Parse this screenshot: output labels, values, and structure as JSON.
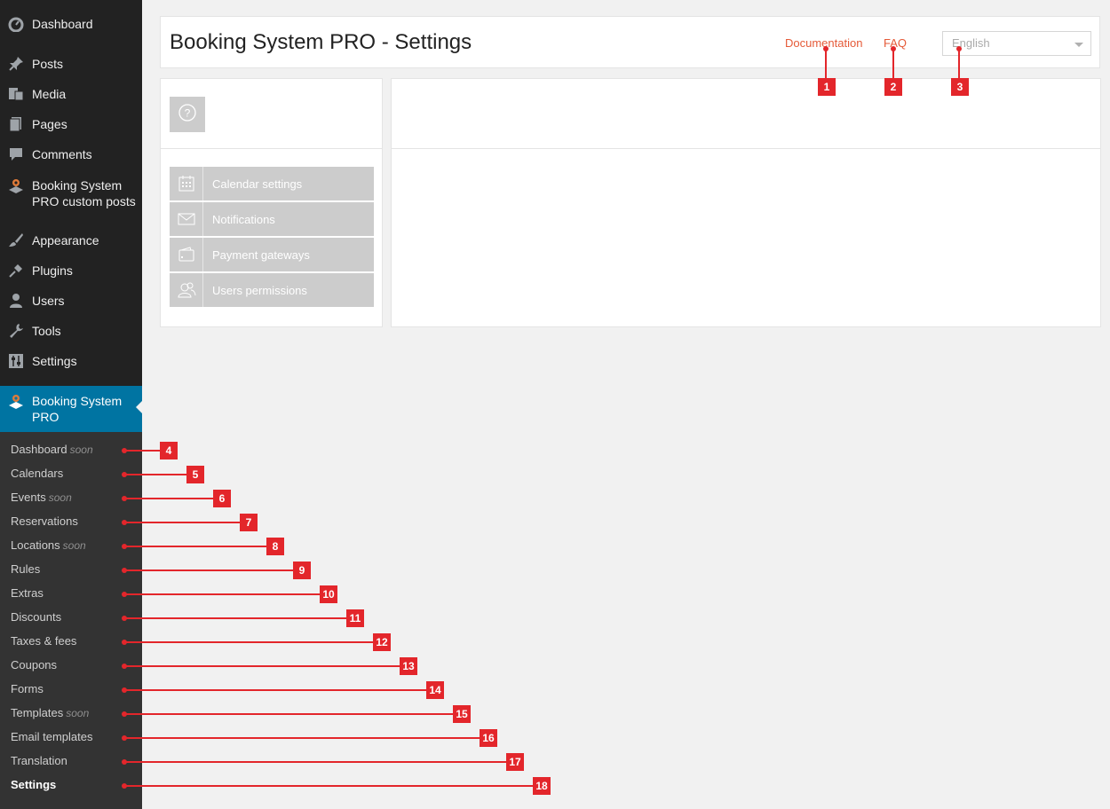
{
  "sidebar": {
    "menu": [
      {
        "label": "Dashboard",
        "icon": "dashboard-icon"
      },
      {
        "label": "Posts",
        "icon": "pin-icon"
      },
      {
        "label": "Media",
        "icon": "media-icon"
      },
      {
        "label": "Pages",
        "icon": "pages-icon"
      },
      {
        "label": "Comments",
        "icon": "comment-icon"
      },
      {
        "label": "Booking System PRO custom posts",
        "line1": "Booking System",
        "line2": "PRO custom posts",
        "icon": "booking-pin-icon"
      },
      {
        "label": "Appearance",
        "icon": "brush-icon"
      },
      {
        "label": "Plugins",
        "icon": "plug-icon"
      },
      {
        "label": "Users",
        "icon": "user-icon"
      },
      {
        "label": "Tools",
        "icon": "wrench-icon"
      },
      {
        "label": "Settings",
        "icon": "settings-sliders-icon"
      }
    ],
    "active": {
      "line1": "Booking System",
      "line2": "PRO",
      "icon": "booking-pin-icon"
    },
    "submenu": [
      {
        "label": "Dashboard",
        "soon": "soon"
      },
      {
        "label": "Calendars",
        "soon": ""
      },
      {
        "label": "Events",
        "soon": "soon"
      },
      {
        "label": "Reservations",
        "soon": ""
      },
      {
        "label": "Locations",
        "soon": "soon"
      },
      {
        "label": "Rules",
        "soon": ""
      },
      {
        "label": "Extras",
        "soon": ""
      },
      {
        "label": "Discounts",
        "soon": ""
      },
      {
        "label": "Taxes & fees",
        "soon": ""
      },
      {
        "label": "Coupons",
        "soon": ""
      },
      {
        "label": "Forms",
        "soon": ""
      },
      {
        "label": "Templates",
        "soon": "soon"
      },
      {
        "label": "Email templates",
        "soon": ""
      },
      {
        "label": "Translation",
        "soon": ""
      },
      {
        "label": "Settings",
        "soon": ""
      }
    ]
  },
  "header": {
    "title": "Booking System PRO - Settings",
    "documentation": "Documentation",
    "faq": "FAQ",
    "language": "English"
  },
  "left_panel": {
    "help_icon": "question-circle-icon",
    "buttons": [
      {
        "label": "Calendar settings",
        "icon": "calendar-icon"
      },
      {
        "label": "Notifications",
        "icon": "envelope-icon"
      },
      {
        "label": "Payment gateways",
        "icon": "wallet-icon"
      },
      {
        "label": "Users permissions",
        "icon": "users-icon"
      }
    ]
  },
  "callouts": [
    "1",
    "2",
    "3",
    "4",
    "5",
    "6",
    "7",
    "8",
    "9",
    "10",
    "11",
    "12",
    "13",
    "14",
    "15",
    "16",
    "17",
    "18"
  ],
  "colors": {
    "accent_link": "#e55a38",
    "callout": "#e3262b",
    "active_menu": "#0074a2",
    "sidebar_bg": "#222222"
  }
}
